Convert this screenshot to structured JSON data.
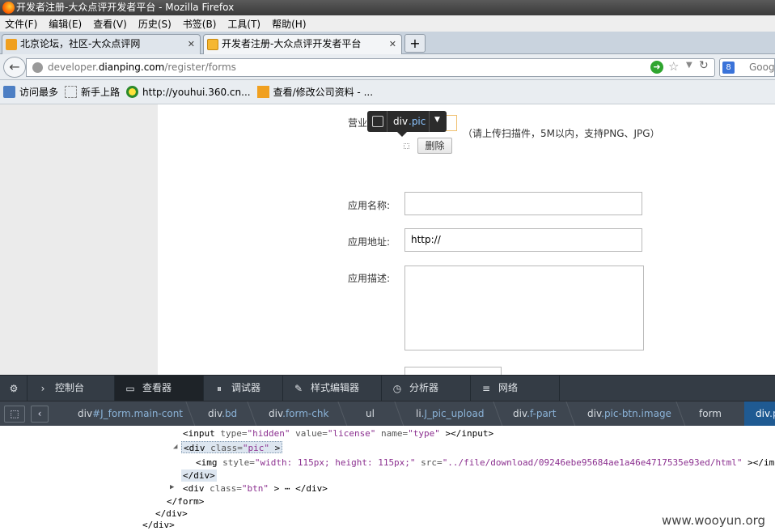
{
  "window": {
    "title": "开发者注册-大众点评开发者平台 - Mozilla Firefox"
  },
  "menu": [
    "文件(F)",
    "编辑(E)",
    "查看(V)",
    "历史(S)",
    "书签(B)",
    "工具(T)",
    "帮助(H)"
  ],
  "tabs": [
    {
      "label": "北京论坛，社区-大众点评网",
      "close": "✕"
    },
    {
      "label": "开发者注册-大众点评开发者平台",
      "close": "✕"
    }
  ],
  "newtab": "+",
  "url": {
    "prefix": "developer.",
    "host": "dianping.com",
    "path": "/register/forms"
  },
  "search": {
    "placeholder": "Google"
  },
  "bookmarks": [
    "访问最多",
    "新手上路",
    "http://youhui.360.cn...",
    "查看/修改公司资料 - ..."
  ],
  "form": {
    "license_label": "营业",
    "upload_hint": "（请上传扫描件，5M以内，支持PNG、JPG）",
    "delete_button": "删除",
    "app_name_label": "应用名称:",
    "app_url_label": "应用地址:",
    "app_url_value": "http://",
    "app_desc_label": "应用描述:"
  },
  "tooltip": {
    "tag": "div",
    "cls": ".pic"
  },
  "devtools": {
    "tabs": [
      "控制台",
      "查看器",
      "调试器",
      "样式编辑器",
      "分析器",
      "网络"
    ],
    "breadcrumbs": [
      {
        "tag": "div",
        "cls": "#J_form.main-cont"
      },
      {
        "tag": "div",
        "cls": ".bd"
      },
      {
        "tag": "div",
        "cls": ".form-chk"
      },
      {
        "tag": "ul",
        "cls": ""
      },
      {
        "tag": "li",
        "cls": ".J_pic_upload"
      },
      {
        "tag": "div",
        "cls": ".f-part"
      },
      {
        "tag": "div",
        "cls": ".pic-btn.image"
      },
      {
        "tag": "form",
        "cls": ""
      },
      {
        "tag": "div",
        "cls": ".p"
      }
    ],
    "markup": {
      "line1_a": "<input ",
      "line1_b": "type=",
      "line1_c": "\"hidden\"",
      "line1_d": " value=",
      "line1_e": "\"license\"",
      "line1_f": " name=",
      "line1_g": "\"type\"",
      "line1_h": "  ></input>",
      "line2_a": "<div ",
      "line2_b": "class=",
      "line2_c": "\"pic\"",
      "line2_d": "  >",
      "line3_a": "<img ",
      "line3_b": "style=",
      "line3_c": "\"width: 115px; height: 115px;\"",
      "line3_d": " src=",
      "line3_e": "\"../file/download/09246ebe95684ae1a46e4717535e93ed/html\"",
      "line3_f": "  ></img>",
      "line4": "</div>",
      "line5_a": "<div ",
      "line5_b": "class=",
      "line5_c": "\"btn\"",
      "line5_d": "  > ⋯ </div>",
      "line6": "</form>",
      "line7": "</div>",
      "line8": "</div>"
    }
  },
  "watermark": "www.wooyun.org",
  "colors": {
    "devtools_bg": "#343c45",
    "selected_crumb": "#1f5a92",
    "go_button": "#2fa52f"
  }
}
